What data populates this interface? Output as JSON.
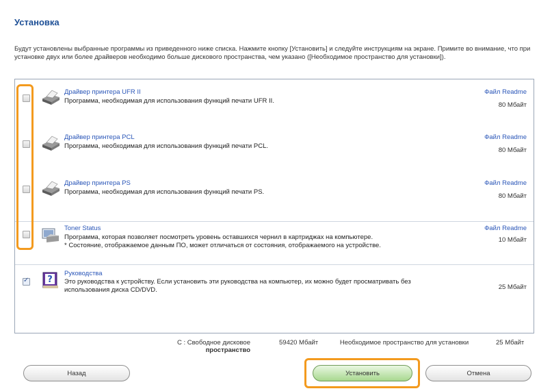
{
  "header": {
    "title": "Установка",
    "intro": "Будут установлены выбранные программы из приведенного ниже списка. Нажмите кнопку [Установить] и следуйте инструкциям на экране. Примите во внимание, что при установке двух или более драйверов необходимо больше дискового пространства, чем указано ([Необходимое пространство для установки])."
  },
  "items": [
    {
      "name": "Драйвер принтера UFR II",
      "description": "Программа, необходимая для использования функций печати UFR II.",
      "readme": "Файл Readme",
      "size": "80 Мбайт",
      "checked": false,
      "icon": "printer-icon"
    },
    {
      "name": "Драйвер принтера PCL",
      "description": "Программа, необходимая для использования функций печати PCL.",
      "readme": "Файл Readme",
      "size": "80 Мбайт",
      "checked": false,
      "icon": "printer-icon"
    },
    {
      "name": "Драйвер принтера PS",
      "description": "Программа, необходимая для использования функций печати PS.",
      "readme": "Файл Readme",
      "size": "80 Мбайт",
      "checked": false,
      "icon": "printer-icon"
    },
    {
      "name": "Toner Status",
      "description": "Программа, которая позволяет посмотреть уровень оставшихся чернил в картриджах на компьютере.",
      "description2": "* Состояние, отображаемое данным ПО, может отличаться от состояния, отображаемого на устройстве.",
      "readme": "Файл Readme",
      "size": "10 Мбайт",
      "checked": false,
      "icon": "toner-status-icon"
    },
    {
      "name": "Руководства",
      "description": "Это руководства к устройству. Если установить эти руководства на компьютер, их можно будет просматривать без использования диска CD/DVD.",
      "size": "25 Мбайт",
      "checked": true,
      "icon": "manual-help-icon"
    }
  ],
  "footer": {
    "drive_label": "С : Свободное дисковое",
    "drive_label_bold": "пространство",
    "free_space": "59420 Мбайт",
    "required_label": "Необходимое пространство для установки",
    "required_size": "25 Мбайт"
  },
  "buttons": {
    "back": "Назад",
    "install": "Установить",
    "cancel": "Отмена"
  },
  "colors": {
    "title": "#1d4f96",
    "link": "#2a56b8",
    "highlight": "#f39a1e",
    "install_button": "#a8d88f"
  }
}
